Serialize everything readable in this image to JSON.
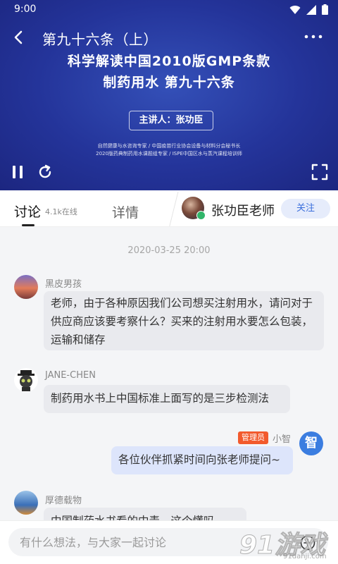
{
  "status_bar": {
    "time": "9:00"
  },
  "video": {
    "title": "第九十六条（上）",
    "slide_line1": "科学解读中国2010版GMP条款",
    "slide_line2": "制药用水 第九十六条",
    "speaker": "主讲人：张功臣",
    "credit_line1": "自然健康与水咨询专家 / 中国疫苗行业协会设备与材料分会秘书长",
    "credit_line2": "2020版药典制药用水课题组专家 / ISPE中国区水与蒸汽课程培训师"
  },
  "tabs": {
    "discuss_label": "讨论",
    "online_count": "4.1k在线",
    "details_label": "详情"
  },
  "teacher": {
    "name": "张功臣老师",
    "follow_label": "关注"
  },
  "chat": {
    "timestamp": "2020-03-25 20:00",
    "messages": [
      {
        "user": "黑皮男孩",
        "text": "老师，由于各种原因我们公司想买注射用水，请问对于供应商应该要考察什么？买来的注射用水要怎么包装，运输和储存"
      },
      {
        "user": "JANE-CHEN",
        "text": "制药用水书上中国标准上面写的是三步检测法"
      },
      {
        "user": "小智",
        "badge": "管理员",
        "avatar_char": "智",
        "text": "各位伙伴抓紧时间向张老师提问~"
      },
      {
        "user": "厚德载物",
        "text": "中国制药水书看的中毒，这个懂吗"
      }
    ]
  },
  "input": {
    "placeholder": "有什么想法，与大家一起讨论"
  },
  "watermark": {
    "main": "91游戏",
    "sub": "91danji.com"
  },
  "colors": {
    "accent": "#3b6fdc",
    "admin_badge": "#f25a2d",
    "video_bg": "#24349a"
  }
}
